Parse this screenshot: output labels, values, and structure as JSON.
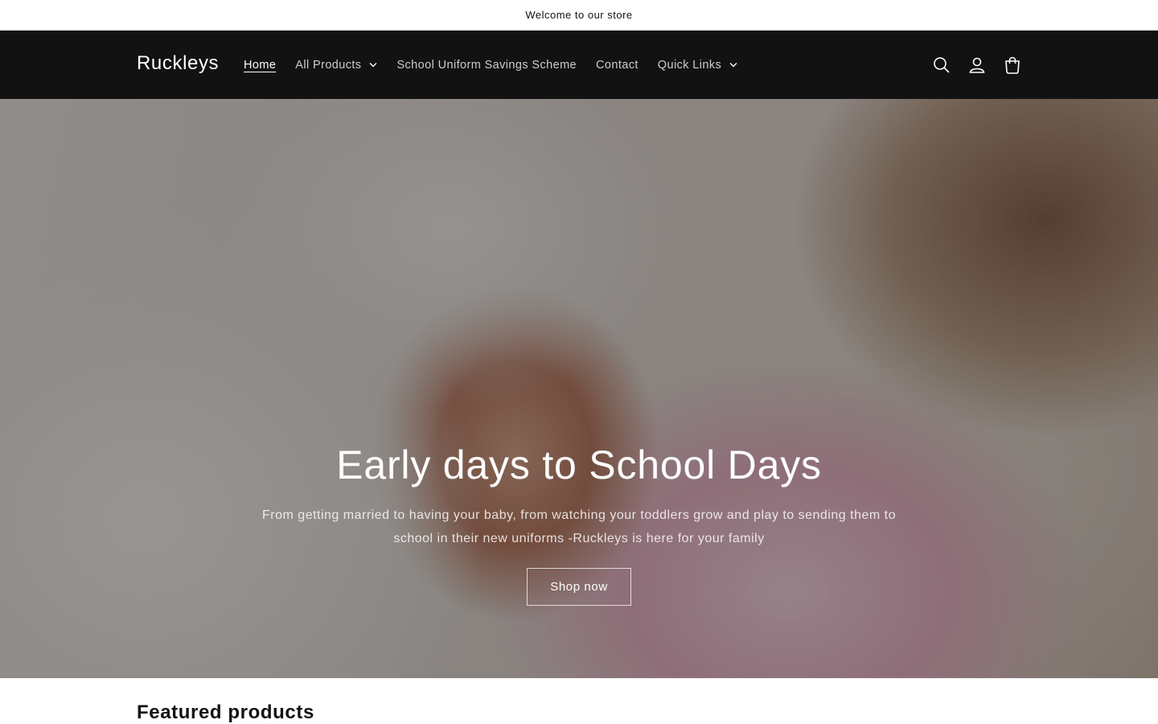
{
  "announcement": {
    "text": "Welcome to our store"
  },
  "header": {
    "logo": "Ruckleys",
    "nav": [
      {
        "label": "Home",
        "active": true,
        "has_dropdown": false
      },
      {
        "label": "All Products",
        "active": false,
        "has_dropdown": true
      },
      {
        "label": "School Uniform Savings Scheme",
        "active": false,
        "has_dropdown": false
      },
      {
        "label": "Contact",
        "active": false,
        "has_dropdown": false
      },
      {
        "label": "Quick Links",
        "active": false,
        "has_dropdown": true
      }
    ],
    "icons": [
      "search-icon",
      "account-icon",
      "cart-icon"
    ]
  },
  "hero": {
    "title": "Early days to School Days",
    "subtitle": "From getting married to having your baby, from watching your toddlers grow and play to sending them to school in their new uniforms -Ruckleys is here for your family",
    "button_label": "Shop now"
  },
  "featured": {
    "heading": "Featured products"
  },
  "colors": {
    "header_bg": "#121212",
    "page_bg": "#ffffff",
    "text": "#121212"
  }
}
